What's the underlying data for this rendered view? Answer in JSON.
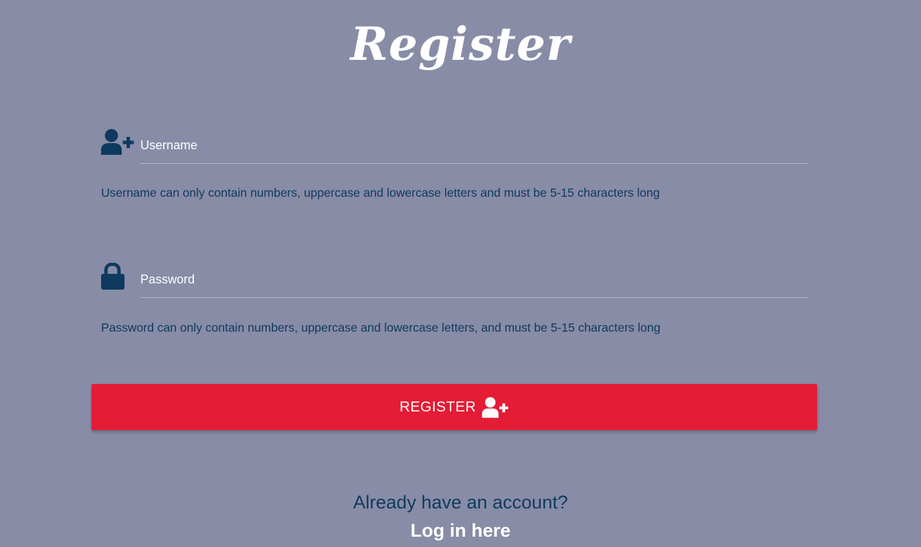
{
  "page_title": "Register",
  "username_field": {
    "placeholder": "Username",
    "value": "",
    "icon": "user-plus-icon",
    "helper": "Username can only contain numbers, uppercase and lowercase letters and must be 5-15 characters long"
  },
  "password_field": {
    "placeholder": "Password",
    "value": "",
    "icon": "lock-icon",
    "helper": "Password can only contain numbers, uppercase and lowercase letters, and must be 5-15 characters long"
  },
  "register_button": {
    "label": "REGISTER",
    "icon": "user-plus-icon"
  },
  "footer": {
    "question": "Already have an account?",
    "login_link": "Log in here"
  },
  "colors": {
    "background": "#888ca6",
    "accent": "#e51c35",
    "dark_text": "#0e3a5f",
    "icon": "#0e3a5f",
    "light_text": "#ffffff"
  }
}
